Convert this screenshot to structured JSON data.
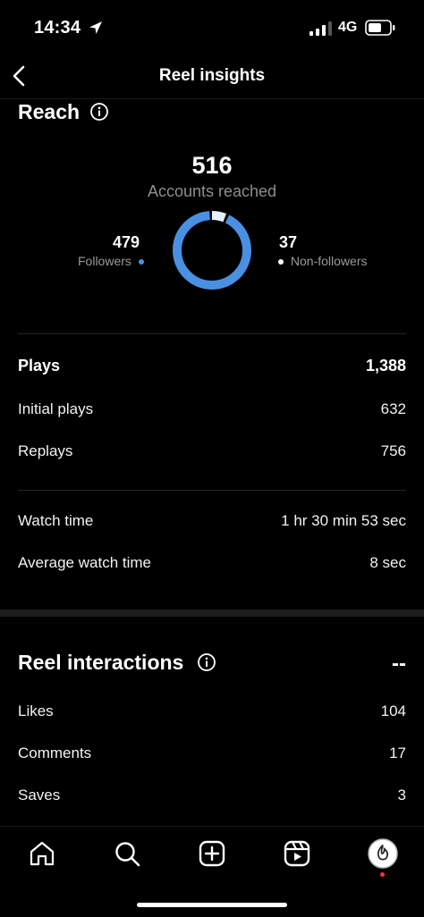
{
  "status_bar": {
    "time": "14:34",
    "network": "4G"
  },
  "header": {
    "title": "Reel insights"
  },
  "reach": {
    "title": "Reach",
    "accounts_reached": "516",
    "accounts_label": "Accounts reached",
    "followers_count": "479",
    "followers_label": "Followers",
    "non_followers_count": "37",
    "non_followers_label": "Non-followers",
    "followers_color": "#4a90e2",
    "non_followers_color": "#e6f0fb"
  },
  "plays": {
    "label": "Plays",
    "value": "1,388",
    "rows": [
      {
        "label": "Initial plays",
        "value": "632"
      },
      {
        "label": "Replays",
        "value": "756"
      }
    ]
  },
  "watch": {
    "rows": [
      {
        "label": "Watch time",
        "value": "1 hr 30 min 53 sec"
      },
      {
        "label": "Average watch time",
        "value": "8 sec"
      }
    ]
  },
  "interactions": {
    "title": "Reel interactions",
    "total": "--",
    "rows": [
      {
        "label": "Likes",
        "value": "104"
      },
      {
        "label": "Comments",
        "value": "17"
      },
      {
        "label": "Saves",
        "value": "3"
      }
    ]
  },
  "nav": {
    "items": [
      "home-icon",
      "search-icon",
      "create-icon",
      "reels-icon",
      "profile-avatar"
    ],
    "notification_color": "#ff3040"
  }
}
